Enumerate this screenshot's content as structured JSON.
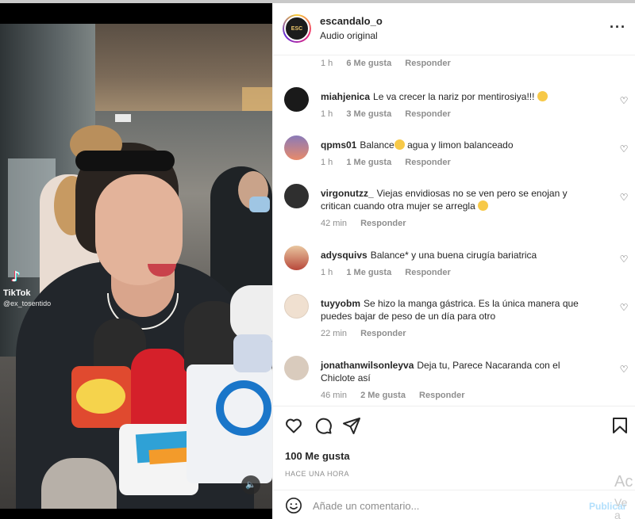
{
  "post": {
    "username": "escandalo_o",
    "audio": "Audio original",
    "more_icon": "more-horizontal-icon",
    "avatar_text": "ESC"
  },
  "video": {
    "watermark_brand": "TikTok",
    "watermark_user": "@ex_tosentido",
    "mute_icon": "speaker-icon"
  },
  "previous_comment_meta": {
    "time": "1 h",
    "likes": "6 Me gusta",
    "reply": "Responder"
  },
  "comments": [
    {
      "user": "miahjenica",
      "text": "Le va crecer la nariz por mentirosiya!!!",
      "time": "1 h",
      "likes": "3 Me gusta",
      "reply": "Responder",
      "avatar_color": "#1a1a1a"
    },
    {
      "user": "qpms01",
      "text": "Balance",
      "text2": "agua y limon balanceado",
      "time": "1 h",
      "likes": "1 Me gusta",
      "reply": "Responder",
      "avatar_color": "#d98a7a"
    },
    {
      "user": "virgonutzz_",
      "text": "Viejas envidiosas no se ven pero se enojan y critican cuando otra mujer se arregla",
      "time": "42 min",
      "likes": "",
      "reply": "Responder",
      "avatar_color": "#3a3a3a"
    },
    {
      "user": "adysquivs",
      "text": "Balance* y una buena cirugía bariatrica",
      "time": "1 h",
      "likes": "1 Me gusta",
      "reply": "Responder",
      "avatar_color": "#c96a5a"
    },
    {
      "user": "tuyyobm",
      "text": "Se hizo la manga gástrica. Es la única manera que puedes bajar de peso de un día para otro",
      "time": "22 min",
      "likes": "",
      "reply": "Responder",
      "avatar_color": "#e8d4c4"
    },
    {
      "user": "jonathanwilsonleyva",
      "text": "Deja tu, Parece Nacaranda con el Chiclote así",
      "time": "46 min",
      "likes": "2 Me gusta",
      "reply": "Responder",
      "avatar_color": "#c8b8a8"
    }
  ],
  "actions": {
    "like_icon": "heart-icon",
    "comment_icon": "comment-icon",
    "share_icon": "send-icon",
    "save_icon": "bookmark-icon",
    "likes_count": "100 Me gusta",
    "time_ago": "HACE UNA HORA"
  },
  "add_comment": {
    "placeholder": "Añade un comentario...",
    "publish_label": "Publicar",
    "emoji_icon": "smile-icon"
  },
  "os_watermark": {
    "line1": "Ac",
    "line2": "Ve a"
  }
}
